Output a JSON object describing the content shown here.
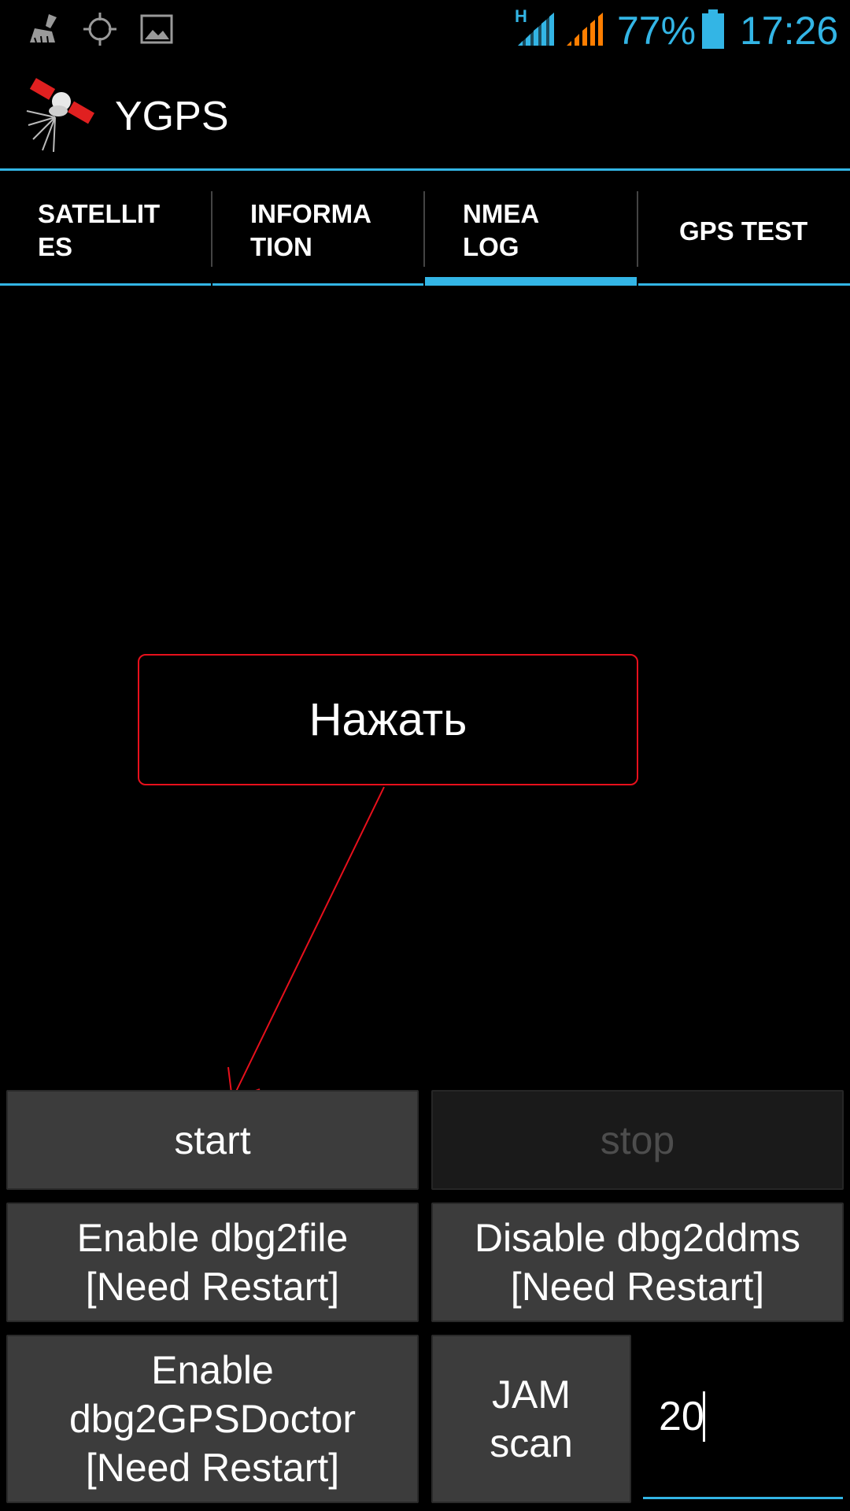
{
  "status_bar": {
    "network_indicator": "H",
    "battery_percent": "77%",
    "time": "17:26",
    "icons": [
      "cleaner-icon",
      "gps-icon",
      "image-icon",
      "signal-icon-sim1",
      "signal-icon-sim2",
      "battery-icon"
    ],
    "colors": {
      "primary": "#33b5e5",
      "secondary": "#ff7e00"
    }
  },
  "app": {
    "title": "YGPS"
  },
  "tabs": [
    {
      "label_line1": "SATELLIT",
      "label_line2": "ES",
      "selected": false
    },
    {
      "label_line1": "INFORMA",
      "label_line2": "TION",
      "selected": false
    },
    {
      "label_line1": "NMEA",
      "label_line2": "LOG",
      "selected": true
    },
    {
      "label_line1": "GPS TEST",
      "label_line2": "",
      "selected": false
    }
  ],
  "annotation": {
    "text": "Нажать",
    "color": "#e8101c"
  },
  "buttons": {
    "start": "start",
    "stop": "stop",
    "dbg2file_line1": "Enable dbg2file",
    "dbg2file_line2": "[Need Restart]",
    "dbg2ddms_line1": "Disable dbg2ddms",
    "dbg2ddms_line2": "[Need Restart]",
    "gpsdoctor_line1": "Enable",
    "gpsdoctor_line2": "dbg2GPSDoctor",
    "gpsdoctor_line3": "[Need Restart]",
    "jam_line1": "JAM",
    "jam_line2": "scan"
  },
  "jam_input": {
    "value": "20"
  }
}
